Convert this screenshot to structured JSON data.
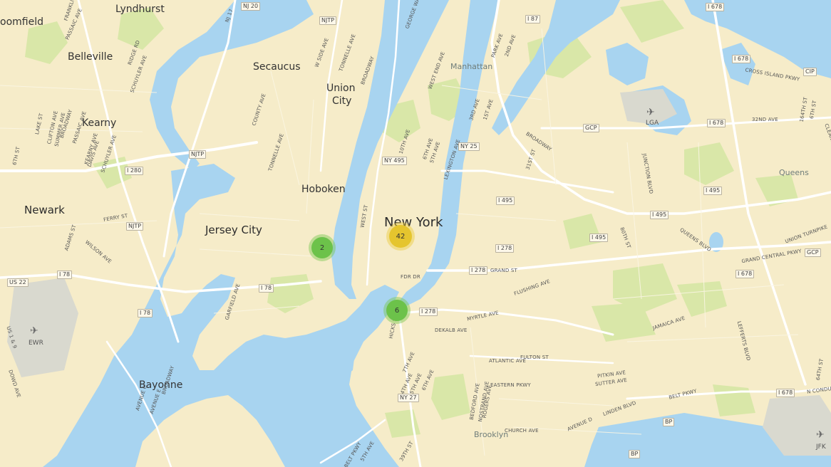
{
  "colors": {
    "land": "#f6ecc9",
    "water": "#a8d4f0",
    "park": "#d9e7a8",
    "road": "#ffffff",
    "cluster_small": "#6cc24a",
    "cluster_medium": "#e5c52e"
  },
  "clusters": {
    "jersey_city": "2",
    "midtown": "42",
    "brooklyn_heights": "6"
  },
  "places": {
    "bloomfield": "oomfield",
    "lyndhurst": "Lyndhurst",
    "belleville": "Belleville",
    "secaucus": "Secaucus",
    "union_city_1": "Union",
    "union_city_2": "City",
    "kearny": "Kearny",
    "newark": "Newark",
    "jersey_city": "Jersey City",
    "hoboken": "Hoboken",
    "new_york": "New York",
    "bayonne": "Bayonne",
    "manhattan": "Manhattan",
    "queens": "Queens",
    "brooklyn": "Brooklyn",
    "lga": "LGA",
    "ewr": "EWR",
    "jfk": "JFK"
  },
  "shields": {
    "i87": "I 87",
    "i678_a": "I 678",
    "i678_b": "I 678",
    "i678_c": "I 678",
    "i678_d": "I 678",
    "i678_e": "I 678",
    "cip": "CIP",
    "njtp_a": "NJTP",
    "njtp_b": "NJTP",
    "njtp_c": "NJTP",
    "i280": "I 280",
    "i78_a": "I 78",
    "i78_b": "I 78",
    "i78_c": "I 78",
    "us22": "US 22",
    "ny495": "NY 495",
    "ny25": "NY 25",
    "i495_a": "I 495",
    "i495_b": "I 495",
    "i495_c": "I 495",
    "i495_d": "I 495",
    "i278_a": "I 278",
    "i278_b": "I 278",
    "i278_c": "I 278",
    "gcp_a": "GCP",
    "gcp_b": "GCP",
    "ny27": "NY 27",
    "bp": "BP",
    "nj20": "NJ 20"
  },
  "streets": {
    "franklin": "FRANKLIN",
    "passaic": "PASSAIC AVE",
    "nj17": "NJ 17",
    "george": "GEORGE WASH",
    "ridge": "RIDGE RD",
    "schuyler": "SCHUYLER AVE",
    "w_side": "W SIDE AVE",
    "tonnelle": "TONNELLE AVE",
    "broadway_a": "BROADWAY",
    "west_end": "WEST END AVE",
    "park_ave": "PARK AVE",
    "second_ave": "2ND AVE",
    "cross_island": "CROSS ISLAND PKWY",
    "sixth_st": "6TH ST",
    "lake": "LAKE ST",
    "clifton": "CLIFTON AVE",
    "summer": "SUMMER AVE",
    "broadway_b": "BROADWAY",
    "passaic_b": "PASSAIC AVE",
    "county": "COUNTY AVE",
    "tenth": "10TH AVE",
    "sixth_ave": "6TH AVE",
    "fifth_ave": "5TH AVE",
    "lexington": "LEXINGTON AVE",
    "third_ave": "3RD AVE",
    "first_ave": "1ST AVE",
    "broadway_c": "BROADWAY",
    "thirty_first": "31ST ST",
    "thirty_second": "32ND AVE",
    "one_sixty_fourth": "164TH ST",
    "junction": "JUNCTION BLVD",
    "kearny_ave": "KEARNY AVE",
    "davis": "DAVIS AVE",
    "schuyler_b": "SCHUYLER AVE",
    "tonnelle_b": "TONNELLE AVE",
    "ferry": "FERRY ST",
    "adams": "ADAMS ST",
    "wilson": "WILSON AVE",
    "west_st": "WEST ST",
    "fdr": "FDR DR",
    "grand_st": "GRAND ST",
    "flushing": "FLUSHING AVE",
    "myrtle": "MYRTLE AVE",
    "dekalb": "DEKALB AVE",
    "queens_blvd": "QUEENS BLVD",
    "eightieth": "80TH ST",
    "union_tpk": "UNION TURNPIKE",
    "gcp_parkway": "GRAND CENTRAL PKWY",
    "garfield": "GARFIELD AVE",
    "hicks": "HICKS ST",
    "jamaica": "JAMAICA AVE",
    "lefferts": "LEFFERTS BLVD",
    "atlantic": "ATLANTIC AVE",
    "fulton": "FULTON ST",
    "pitkin": "PITKIN AVE",
    "sutter": "SUTTER AVE",
    "eastern": "EASTERN PKWY",
    "bedford": "BEDFORD AVE",
    "nostrand": "NOSTRAND AVE",
    "rogers": "ROGERS AVE",
    "fourth_ave": "4TH AVE",
    "fifth_ave_b": "5TH AVE",
    "sixth_ave_b": "6TH AVE",
    "seventh_ave": "7TH AVE",
    "avenue_c": "AVENUE C",
    "avenue_e": "AVENUE E",
    "broadway_d": "BROADWAY",
    "dowd": "DOWD AVE",
    "us19": "US 1 & 9",
    "belt": "BELT PKWY",
    "linden": "LINDEN BLVD",
    "avenue_d": "AVENUE D",
    "church": "CHURCH AVE",
    "conduit": "N CONDUIT",
    "thirty_ninth": "39TH ST",
    "fifth_ave_c": "5TH AVE",
    "belt_b": "BELT PKWY",
    "sixty_fourth": "64TH ST",
    "sixth_st_b": "6TH ST",
    "clearview": "CLEARVIEW"
  }
}
